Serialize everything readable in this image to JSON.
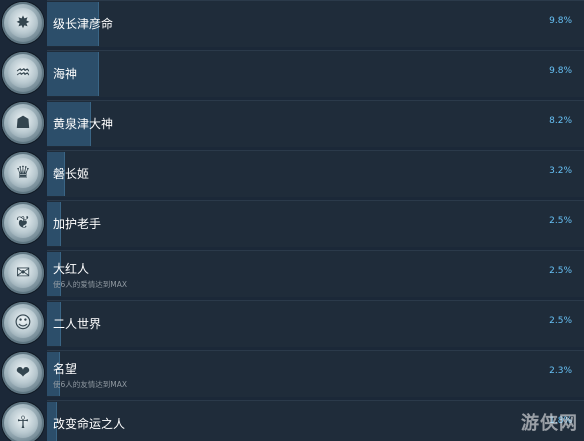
{
  "achievements": [
    {
      "name": "级长津彦命",
      "desc": "",
      "percent": "9.8%",
      "fill": 0.098,
      "icon": "dragon-helm-icon",
      "glyph": "✸"
    },
    {
      "name": "海神",
      "desc": "",
      "percent": "9.8%",
      "fill": 0.098,
      "icon": "sea-serpent-icon",
      "glyph": "♒"
    },
    {
      "name": "黄泉津大神",
      "desc": "",
      "percent": "8.2%",
      "fill": 0.082,
      "icon": "oni-mask-icon",
      "glyph": "☗"
    },
    {
      "name": "磐长姬",
      "desc": "",
      "percent": "3.2%",
      "fill": 0.032,
      "icon": "princess-icon",
      "glyph": "♛"
    },
    {
      "name": "加护老手",
      "desc": "",
      "percent": "2.5%",
      "fill": 0.025,
      "icon": "guardian-bird-icon",
      "glyph": "❦"
    },
    {
      "name": "大红人",
      "desc": "使6人的爱情达到MAX",
      "percent": "2.5%",
      "fill": 0.025,
      "icon": "love-letter-icon",
      "glyph": "✉"
    },
    {
      "name": "二人世界",
      "desc": "",
      "percent": "2.5%",
      "fill": 0.025,
      "icon": "couple-icon",
      "glyph": "☺"
    },
    {
      "name": "名望",
      "desc": "使6人的友情达到MAX",
      "percent": "2.3%",
      "fill": 0.023,
      "icon": "heart-circle-icon",
      "glyph": "❤"
    },
    {
      "name": "改变命运之人",
      "desc": "",
      "percent": "1.8%",
      "fill": 0.018,
      "icon": "destiny-figure-icon",
      "glyph": "☥"
    }
  ],
  "watermark": "游侠网"
}
